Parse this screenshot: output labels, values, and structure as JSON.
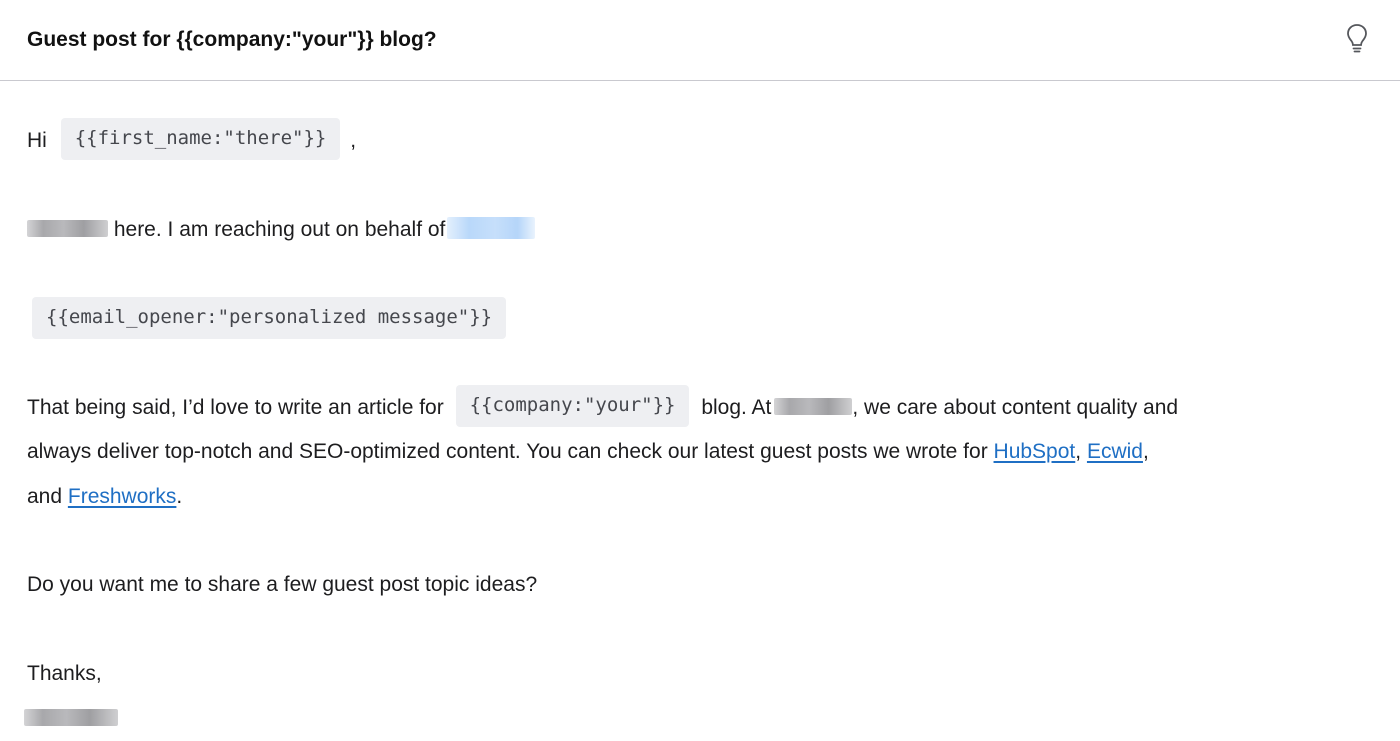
{
  "email": {
    "subject": "Guest post for {{company:\"your\"}} blog?",
    "greeting_prefix": "Hi",
    "first_name_var": "{{first_name:\"there\"}}",
    "greeting_suffix": ",",
    "intro_text": " here. I am reaching out on behalf of",
    "opener_var": "{{email_opener:\"personalized message\"}}",
    "para1_a": "That being said, I’d love to write an article for",
    "company_var": "{{company:\"your\"}}",
    "para1_b": "blog. At",
    "para1_c": ", we care about content quality and",
    "para2_a": "always deliver top-notch and SEO-optimized content. You can check our latest guest posts we wrote for ",
    "link_hubspot": "HubSpot",
    "sep1": ", ",
    "link_ecwid": "Ecwid",
    "sep2": ",",
    "para3_a": "and ",
    "link_freshworks": "Freshworks",
    "para3_b": ".",
    "question": "Do you want me to share a few guest post topic ideas?",
    "closing": "Thanks,"
  },
  "icons": {
    "hint": "lightbulb-icon"
  },
  "colors": {
    "link": "#1f6fc4",
    "variable_bg": "#eeeff2",
    "divider": "#c9c9cf"
  }
}
